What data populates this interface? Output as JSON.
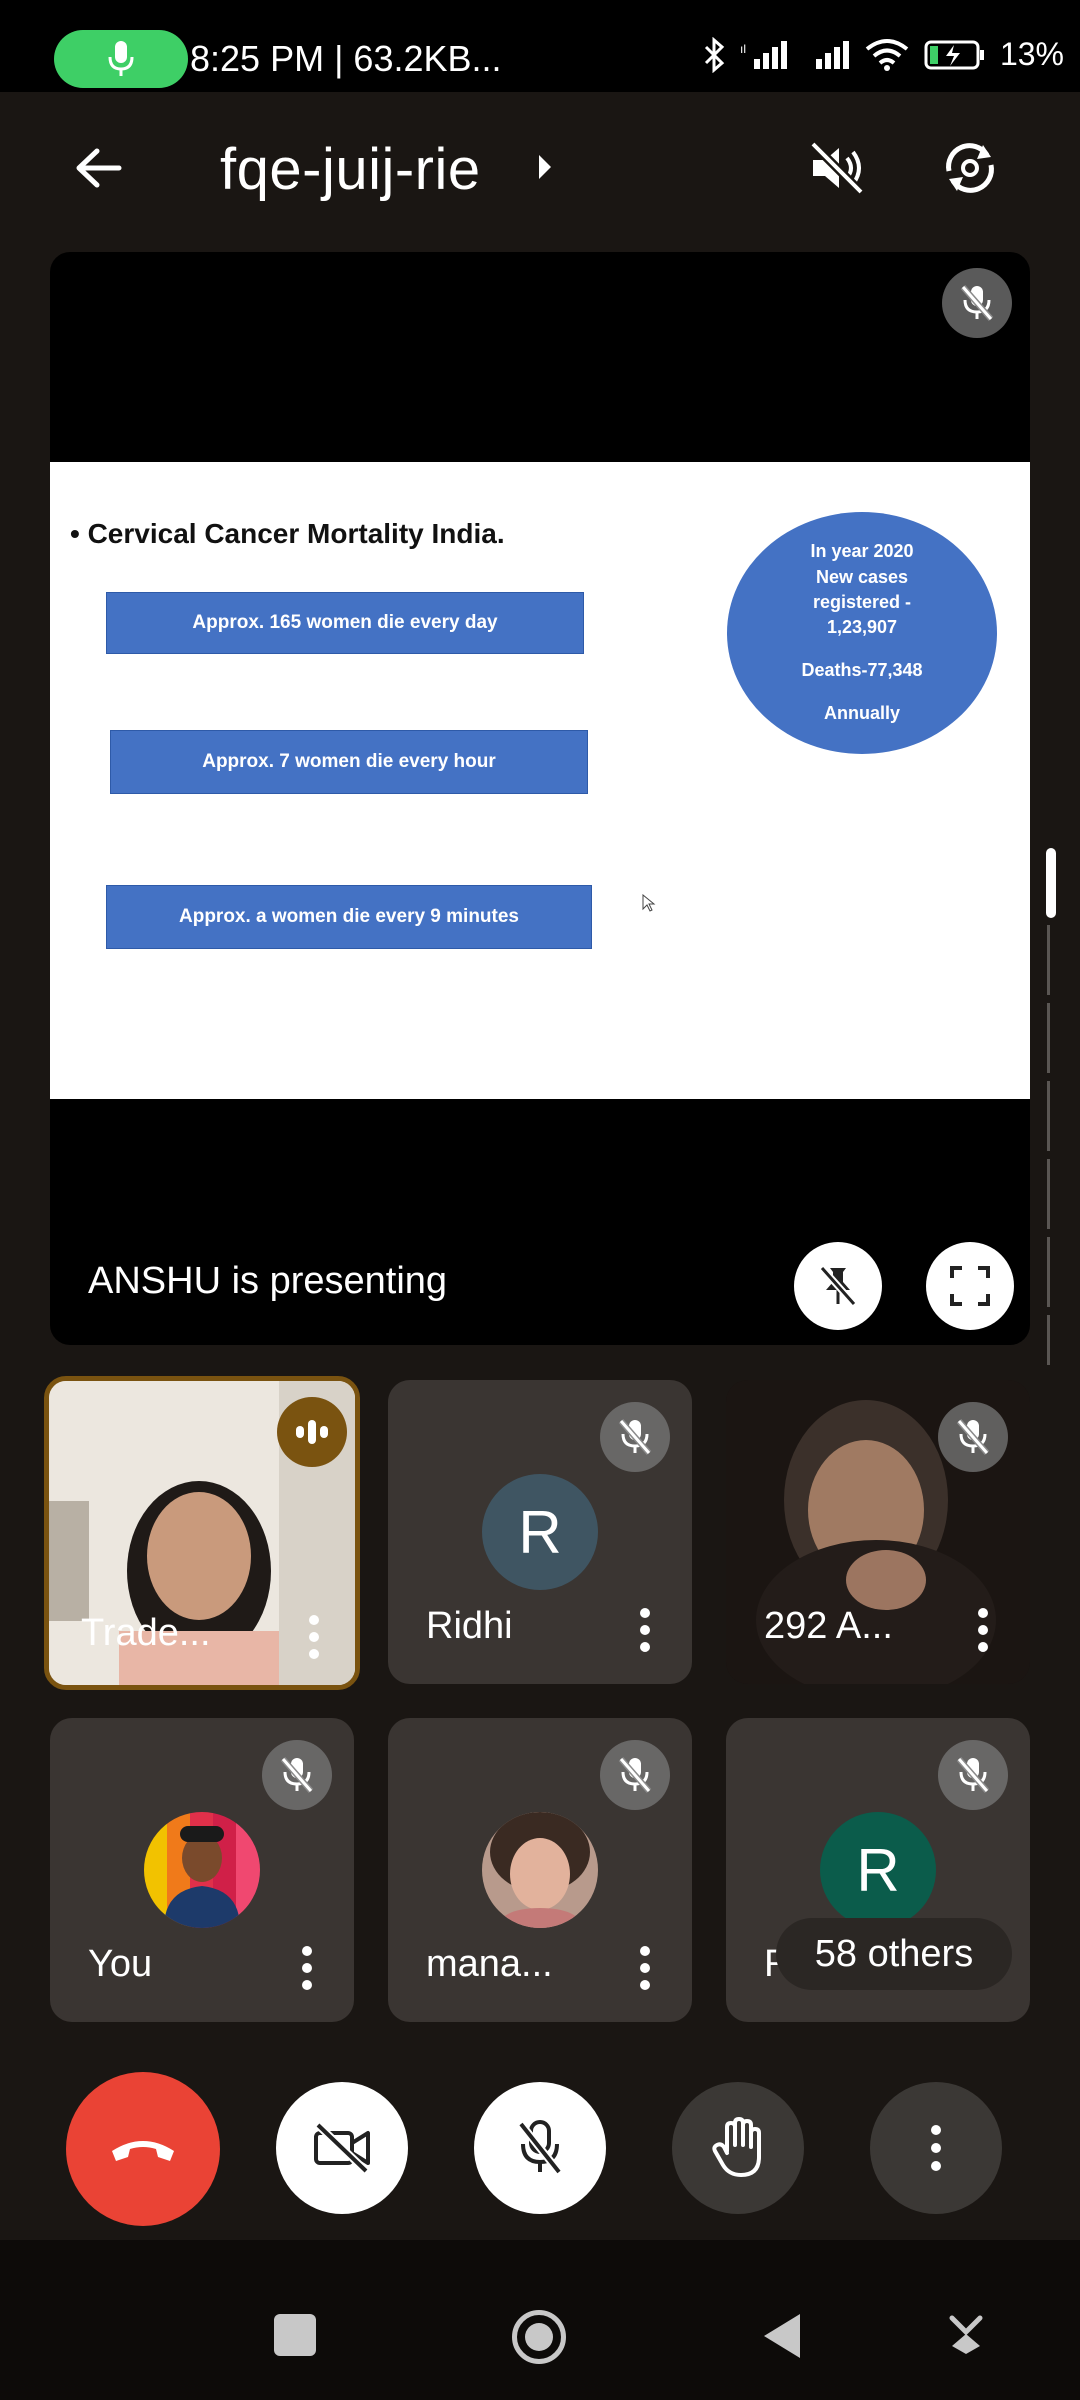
{
  "status_bar": {
    "text": "8:25 PM | 63.2KB...",
    "battery": "13%"
  },
  "header": {
    "meeting_code": "fqe-juij-rie"
  },
  "presentation": {
    "presenter_label": "ANSHU is presenting",
    "slide": {
      "title": "• Cervical Cancer Mortality India.",
      "boxes": [
        "Approx. 165 women die every day",
        "Approx. 7 women die every hour",
        "Approx. a women die every 9 minutes"
      ],
      "ellipse_lines": [
        "In year 2020",
        "New cases",
        "registered -",
        "1,23,907",
        "",
        "Deaths-77,348",
        "",
        "Annually"
      ]
    }
  },
  "participants": [
    {
      "name": "Trade...",
      "type": "video",
      "speaking": true
    },
    {
      "name": "Ridhi",
      "type": "letter",
      "letter": "R",
      "color": "#3f5562",
      "muted": true
    },
    {
      "name": "292 A...",
      "type": "video",
      "muted": true
    },
    {
      "name": "You",
      "type": "photo",
      "muted": true
    },
    {
      "name": "mana...",
      "type": "photo",
      "muted": true
    },
    {
      "name": "Ro...",
      "type": "letter",
      "letter": "R",
      "color": "#0b5c4b",
      "muted": true,
      "overlay": "58 others"
    }
  ],
  "colors": {
    "end_call": "#ea4335",
    "speaking_border": "#7a5310",
    "mic_pill": "#3ecf66"
  },
  "icons": {
    "back": "arrow-left-icon",
    "audio": "speaker-off-icon",
    "camera_switch": "camera-switch-icon"
  }
}
